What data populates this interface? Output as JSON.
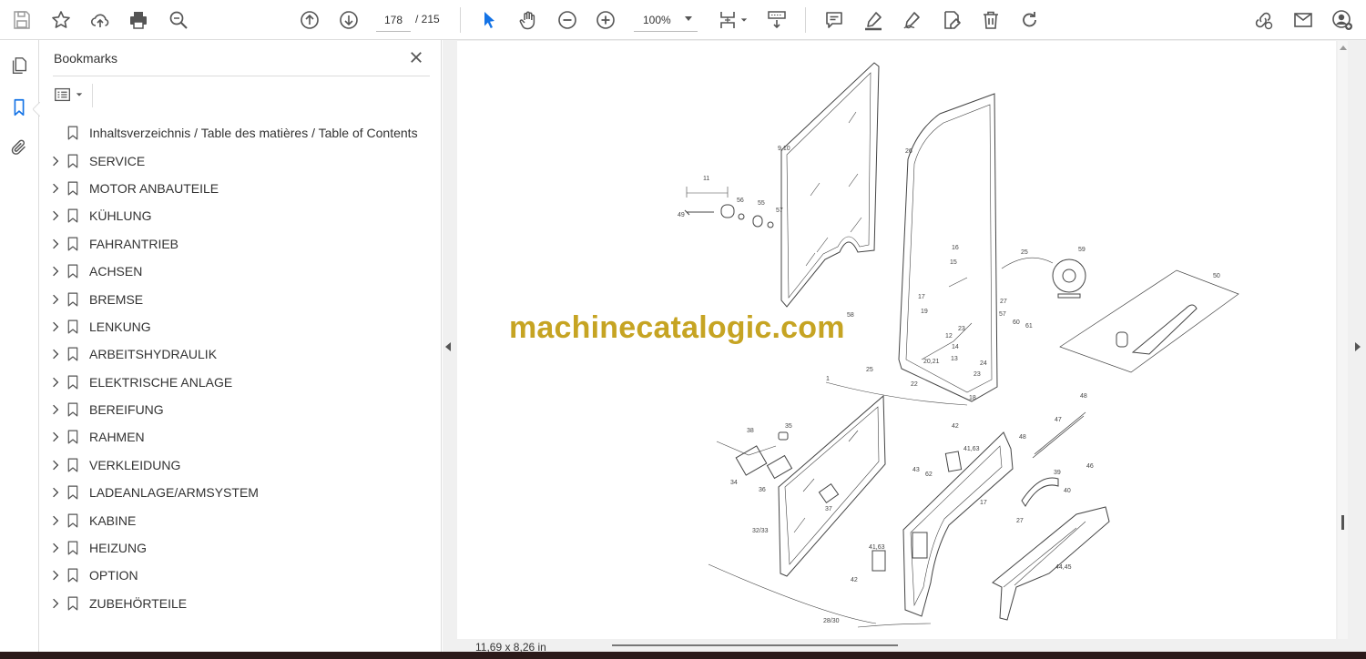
{
  "toolbar": {
    "page_current": "178",
    "page_total": "/ 215",
    "zoom": "100%"
  },
  "panel": {
    "title": "Bookmarks",
    "items": [
      {
        "label": "Inhaltsverzeichnis / Table des matières / Table of Contents",
        "expandable": false
      },
      {
        "label": "SERVICE",
        "expandable": true
      },
      {
        "label": "MOTOR ANBAUTEILE",
        "expandable": true
      },
      {
        "label": "KÜHLUNG",
        "expandable": true
      },
      {
        "label": "FAHRANTRIEB",
        "expandable": true
      },
      {
        "label": "ACHSEN",
        "expandable": true
      },
      {
        "label": "BREMSE",
        "expandable": true
      },
      {
        "label": "LENKUNG",
        "expandable": true
      },
      {
        "label": "ARBEITSHYDRAULIK",
        "expandable": true
      },
      {
        "label": "ELEKTRISCHE ANLAGE",
        "expandable": true
      },
      {
        "label": "BEREIFUNG",
        "expandable": true
      },
      {
        "label": "RAHMEN",
        "expandable": true
      },
      {
        "label": "VERKLEIDUNG",
        "expandable": true
      },
      {
        "label": "LADEANLAGE/ARMSYSTEM",
        "expandable": true
      },
      {
        "label": "KABINE",
        "expandable": true
      },
      {
        "label": "HEIZUNG",
        "expandable": true
      },
      {
        "label": "OPTION",
        "expandable": true
      },
      {
        "label": "ZUBEHÖRTEILE",
        "expandable": true
      }
    ]
  },
  "document": {
    "watermark": "machinecatalogic.com",
    "callouts": {
      "c1": "9,10",
      "c2": "26",
      "c3": "11",
      "c4": "49",
      "c5": "56",
      "c6": "55",
      "c7": "57",
      "c8": "16",
      "c9": "15",
      "c10": "25",
      "c11": "59",
      "c12": "50",
      "c13": "17",
      "c14": "27",
      "c15": "19",
      "c16": "57",
      "c17": "60",
      "c18": "61",
      "c19": "58",
      "c20": "23",
      "c21": "12",
      "c22": "14",
      "c23": "13",
      "c24": "20,21",
      "c25": "24",
      "c26": "25",
      "c27": "23",
      "c28": "1",
      "c29": "22",
      "c30": "18",
      "c31": "48",
      "c32": "47",
      "c33": "48",
      "c34": "38",
      "c35": "35",
      "c36": "42",
      "c37": "41,63",
      "c38": "43",
      "c39": "62",
      "c40": "34",
      "c41": "36",
      "c42": "39",
      "c43": "40",
      "c44": "46",
      "c45": "37",
      "c46": "17",
      "c47": "27",
      "c48": "32/33",
      "c49": "41,63",
      "c50": "42",
      "c51": "44,45",
      "c52": "28/30"
    }
  },
  "status": {
    "page_size": "11,69 x 8,26 in"
  },
  "colors": {
    "watermark": "#c6a423",
    "accent": "#1473e6",
    "text": "#333333"
  }
}
